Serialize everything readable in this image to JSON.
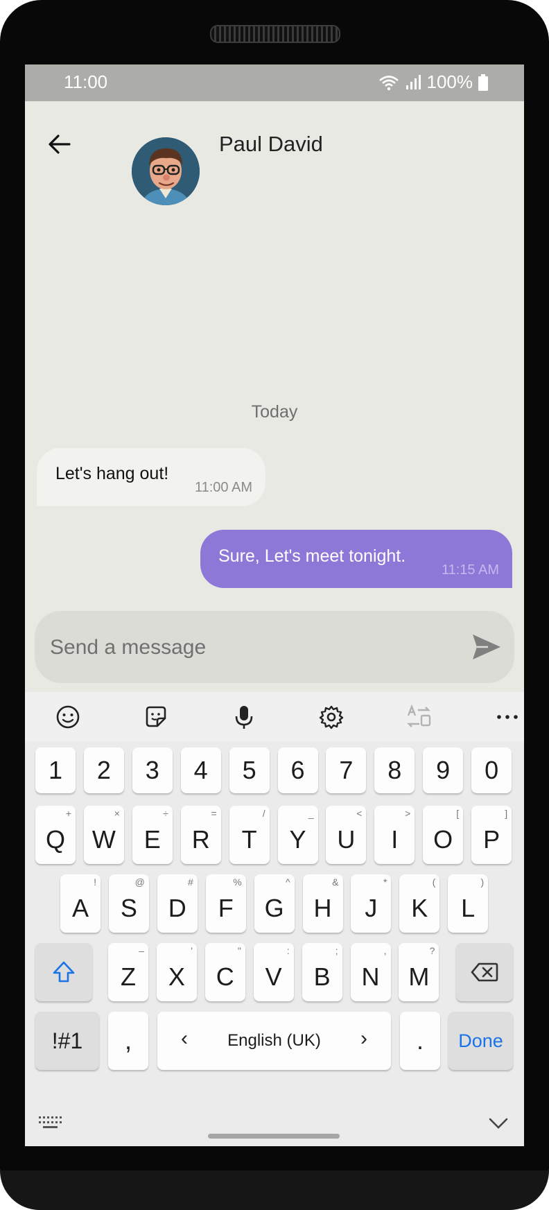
{
  "status_bar": {
    "time": "11:00",
    "battery": "100%"
  },
  "header": {
    "contact_name": "Paul David"
  },
  "conversation": {
    "date_separator": "Today",
    "messages": [
      {
        "direction": "incoming",
        "text": "Let's hang out!",
        "time": "11:00 AM"
      },
      {
        "direction": "outgoing",
        "text": "Sure, Let's meet tonight.",
        "time": "11:15 AM"
      }
    ]
  },
  "composer": {
    "placeholder": "Send a message"
  },
  "keyboard": {
    "toolbar": [
      "emoji-icon",
      "sticker-icon",
      "microphone-icon",
      "settings-icon",
      "translate-icon",
      "more-icon"
    ],
    "number_row": [
      "1",
      "2",
      "3",
      "4",
      "5",
      "6",
      "7",
      "8",
      "9",
      "0"
    ],
    "row1": [
      {
        "key": "Q",
        "sub": "+"
      },
      {
        "key": "W",
        "sub": "×"
      },
      {
        "key": "E",
        "sub": "÷"
      },
      {
        "key": "R",
        "sub": "="
      },
      {
        "key": "T",
        "sub": "/"
      },
      {
        "key": "Y",
        "sub": "_"
      },
      {
        "key": "U",
        "sub": "<"
      },
      {
        "key": "I",
        "sub": ">"
      },
      {
        "key": "O",
        "sub": "["
      },
      {
        "key": "P",
        "sub": "]"
      }
    ],
    "row2": [
      {
        "key": "A",
        "sub": "!"
      },
      {
        "key": "S",
        "sub": "@"
      },
      {
        "key": "D",
        "sub": "#"
      },
      {
        "key": "F",
        "sub": "%"
      },
      {
        "key": "G",
        "sub": "^"
      },
      {
        "key": "H",
        "sub": "&"
      },
      {
        "key": "J",
        "sub": "*"
      },
      {
        "key": "K",
        "sub": "("
      },
      {
        "key": "L",
        "sub": ")"
      }
    ],
    "row3": [
      {
        "key": "Z",
        "sub": "–"
      },
      {
        "key": "X",
        "sub": "'"
      },
      {
        "key": "C",
        "sub": "\""
      },
      {
        "key": "V",
        "sub": ":"
      },
      {
        "key": "B",
        "sub": ";"
      },
      {
        "key": "N",
        "sub": ","
      },
      {
        "key": "M",
        "sub": "?"
      }
    ],
    "symbols_label": "!#1",
    "comma": ",",
    "language": "English (UK)",
    "period": ".",
    "done_label": "Done"
  },
  "colors": {
    "accent": "#8d78d7",
    "done": "#1a73e8"
  }
}
